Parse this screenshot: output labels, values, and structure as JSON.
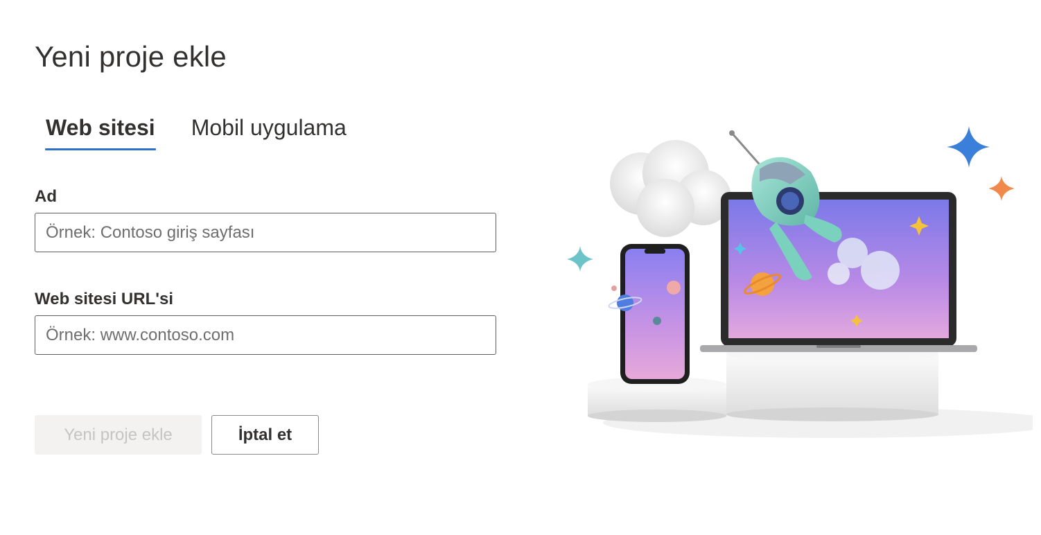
{
  "dialog": {
    "title": "Yeni proje ekle"
  },
  "tabs": [
    {
      "label": "Web sitesi",
      "active": true
    },
    {
      "label": "Mobil uygulama",
      "active": false
    }
  ],
  "form": {
    "name": {
      "label": "Ad",
      "value": "",
      "placeholder": "Örnek: Contoso giriş sayfası"
    },
    "url": {
      "label": "Web sitesi URL'si",
      "value": "",
      "placeholder": "Örnek: www.contoso.com"
    }
  },
  "actions": {
    "submit_label": "Yeni proje ekle",
    "submit_enabled": false,
    "cancel_label": "İptal et"
  },
  "illustration": {
    "icons": [
      "cloud-icon",
      "rocket-icon",
      "laptop-icon",
      "phone-icon",
      "planet-icon",
      "sparkle-icon"
    ],
    "colors": {
      "accent_blue": "#2f6fc9",
      "screen_top": "#7b79e8",
      "screen_bottom": "#dc9ee0",
      "star_blue": "#3a7fd9",
      "star_orange": "#f08a4b",
      "star_teal": "#6cc3c8"
    }
  }
}
